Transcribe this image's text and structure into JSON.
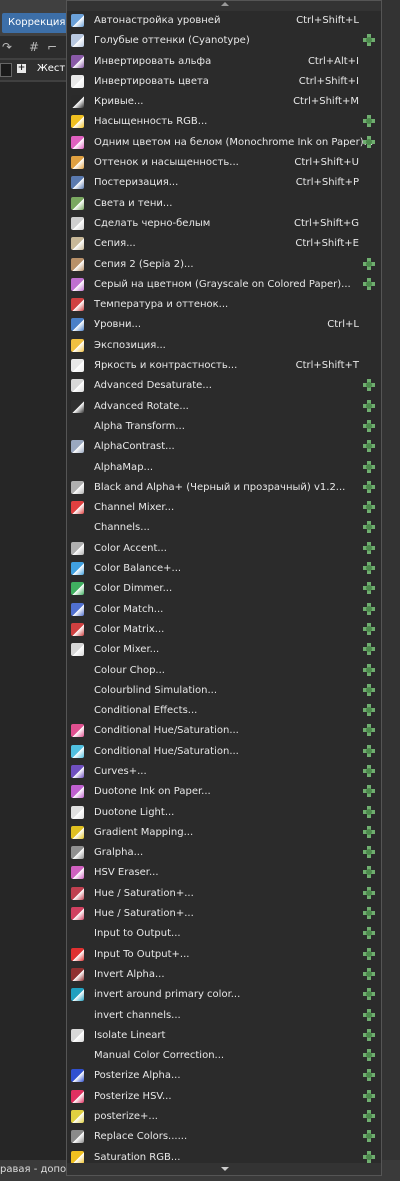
{
  "menubar": {
    "active_menu": "Коррекция"
  },
  "options": {
    "label": "Жестко"
  },
  "status": {
    "text": "равая - допол"
  },
  "menu": {
    "items": [
      {
        "label": "Автонастройка уровней",
        "shortcut": "Ctrl+Shift+L",
        "icon": "auto-levels-icon",
        "color": "#6aa0d8",
        "plugin": false
      },
      {
        "label": "Голубые оттенки (Cyanotype)",
        "shortcut": "",
        "icon": "cyanotype-icon",
        "color": "#b8c8e0",
        "plugin": true
      },
      {
        "label": "Инвертировать альфа",
        "shortcut": "Ctrl+Alt+I",
        "icon": "invert-alpha-icon",
        "color": "#8a5aa8",
        "plugin": false
      },
      {
        "label": "Инвертировать цвета",
        "shortcut": "Ctrl+Shift+I",
        "icon": "invert-colors-icon",
        "color": "#e8e8e8",
        "plugin": false
      },
      {
        "label": "Кривые...",
        "shortcut": "Ctrl+Shift+M",
        "icon": "curves-icon",
        "color": "#2a2a2a",
        "plugin": false
      },
      {
        "label": "Насыщенность RGB...",
        "shortcut": "",
        "icon": "rgb-saturation-icon",
        "color": "#f0c020",
        "plugin": true
      },
      {
        "label": "Одним цветом на белом (Monochrome Ink on Paper)...",
        "shortcut": "",
        "icon": "monochrome-ink-icon",
        "color": "#e060c0",
        "plugin": true
      },
      {
        "label": "Оттенок и насыщенность...",
        "shortcut": "Ctrl+Shift+U",
        "icon": "hue-saturation-icon",
        "color": "#e0a040",
        "plugin": false
      },
      {
        "label": "Постеризация...",
        "shortcut": "Ctrl+Shift+P",
        "icon": "posterize-icon",
        "color": "#5a7ab0",
        "plugin": false
      },
      {
        "label": "Света и тени...",
        "shortcut": "",
        "icon": "shadows-highlights-icon",
        "color": "#7aa860",
        "plugin": false
      },
      {
        "label": "Сделать черно-белым",
        "shortcut": "Ctrl+Shift+G",
        "icon": "black-white-icon",
        "color": "#cfcfcf",
        "plugin": false
      },
      {
        "label": "Сепия...",
        "shortcut": "Ctrl+Shift+E",
        "icon": "sepia-icon",
        "color": "#c8b898",
        "plugin": false
      },
      {
        "label": "Сепия 2 (Sepia 2)...",
        "shortcut": "",
        "icon": "sepia-2-icon",
        "color": "#b89068",
        "plugin": true
      },
      {
        "label": "Серый на цветном (Grayscale on Colored Paper)...",
        "shortcut": "",
        "icon": "grayscale-colored-paper-icon",
        "color": "#c070d0",
        "plugin": true
      },
      {
        "label": "Температура и оттенок...",
        "shortcut": "",
        "icon": "temperature-tint-icon",
        "color": "#d04040",
        "plugin": false
      },
      {
        "label": "Уровни...",
        "shortcut": "Ctrl+L",
        "icon": "levels-icon",
        "color": "#4a80c8",
        "plugin": false
      },
      {
        "label": "Экспозиция...",
        "shortcut": "",
        "icon": "exposure-bulb-icon",
        "color": "#f0c040",
        "plugin": false
      },
      {
        "label": "Яркость и контрастность...",
        "shortcut": "Ctrl+Shift+T",
        "icon": "brightness-contrast-icon",
        "color": "#e8e8e8",
        "plugin": false
      },
      {
        "label": "Advanced Desaturate...",
        "shortcut": "",
        "icon": "advanced-desaturate-icon",
        "color": "#d8d8d8",
        "plugin": true
      },
      {
        "label": "Advanced Rotate...",
        "shortcut": "",
        "icon": "advanced-rotate-icon",
        "color": "#303030",
        "plugin": true
      },
      {
        "label": "Alpha Transform...",
        "shortcut": "",
        "icon": "",
        "color": "",
        "plugin": true
      },
      {
        "label": "AlphaContrast...",
        "shortcut": "",
        "icon": "alpha-contrast-icon",
        "color": "#9aa8c0",
        "plugin": true
      },
      {
        "label": "AlphaMap...",
        "shortcut": "",
        "icon": "",
        "color": "",
        "plugin": true
      },
      {
        "label": "Black and Alpha+ (Черный и прозрачный) v1.2...",
        "shortcut": "",
        "icon": "black-alpha-icon",
        "color": "#b0b0b0",
        "plugin": true
      },
      {
        "label": "Channel Mixer...",
        "shortcut": "",
        "icon": "channel-mixer-icon",
        "color": "#e04040",
        "plugin": true
      },
      {
        "label": "Channels...",
        "shortcut": "",
        "icon": "",
        "color": "",
        "plugin": true
      },
      {
        "label": "Color Accent...",
        "shortcut": "",
        "icon": "color-accent-icon",
        "color": "#b0b0b0",
        "plugin": true
      },
      {
        "label": "Color Balance+...",
        "shortcut": "",
        "icon": "color-balance-icon",
        "color": "#40a0e0",
        "plugin": true
      },
      {
        "label": "Color Dimmer...",
        "shortcut": "",
        "icon": "color-dimmer-icon",
        "color": "#40b060",
        "plugin": true
      },
      {
        "label": "Color Match...",
        "shortcut": "",
        "icon": "color-match-icon",
        "color": "#5070d0",
        "plugin": true
      },
      {
        "label": "Color Matrix...",
        "shortcut": "",
        "icon": "color-matrix-icon",
        "color": "#d04040",
        "plugin": true
      },
      {
        "label": "Color Mixer...",
        "shortcut": "",
        "icon": "color-mixer-icon",
        "color": "#d8d8d8",
        "plugin": true
      },
      {
        "label": "Colour Chop...",
        "shortcut": "",
        "icon": "",
        "color": "",
        "plugin": true
      },
      {
        "label": "Colourblind Simulation...",
        "shortcut": "",
        "icon": "",
        "color": "",
        "plugin": true
      },
      {
        "label": "Conditional Effects...",
        "shortcut": "",
        "icon": "",
        "color": "",
        "plugin": true
      },
      {
        "label": "Conditional Hue/Saturation...",
        "shortcut": "",
        "icon": "conditional-hue-icon",
        "color": "#e05090",
        "plugin": true
      },
      {
        "label": "Conditional Hue/Saturation...",
        "shortcut": "",
        "icon": "conditional-hue-2-icon",
        "color": "#50c0e0",
        "plugin": true
      },
      {
        "label": "Curves+...",
        "shortcut": "",
        "icon": "curves-plus-icon",
        "color": "#7050c0",
        "plugin": true
      },
      {
        "label": "Duotone Ink on Paper...",
        "shortcut": "",
        "icon": "duotone-ink-icon",
        "color": "#c060d0",
        "plugin": true
      },
      {
        "label": "Duotone Light...",
        "shortcut": "",
        "icon": "duotone-light-icon",
        "color": "#e0e0e0",
        "plugin": true
      },
      {
        "label": "Gradient Mapping...",
        "shortcut": "",
        "icon": "gradient-mapping-icon",
        "color": "#e0c020",
        "plugin": true
      },
      {
        "label": "Gralpha...",
        "shortcut": "",
        "icon": "gralpha-icon",
        "color": "#909090",
        "plugin": true
      },
      {
        "label": "HSV Eraser...",
        "shortcut": "",
        "icon": "hsv-eraser-icon",
        "color": "#d060c0",
        "plugin": true
      },
      {
        "label": "Hue / Saturation+...",
        "shortcut": "",
        "icon": "hue-saturation-plus-icon",
        "color": "#c04050",
        "plugin": true
      },
      {
        "label": "Hue / Saturation+...",
        "shortcut": "",
        "icon": "hue-saturation-plus-2-icon",
        "color": "#d04060",
        "plugin": true
      },
      {
        "label": "Input to Output...",
        "shortcut": "",
        "icon": "",
        "color": "",
        "plugin": true
      },
      {
        "label": "Input To Output+...",
        "shortcut": "",
        "icon": "input-to-output-icon",
        "color": "#e03030",
        "plugin": true
      },
      {
        "label": "Invert Alpha...",
        "shortcut": "",
        "icon": "invert-alpha-2-icon",
        "color": "#903030",
        "plugin": true
      },
      {
        "label": "invert around primary color...",
        "shortcut": "",
        "icon": "invert-primary-icon",
        "color": "#20a0c0",
        "plugin": true
      },
      {
        "label": "invert channels...",
        "shortcut": "",
        "icon": "",
        "color": "",
        "plugin": true
      },
      {
        "label": "Isolate Lineart",
        "shortcut": "",
        "icon": "isolate-lineart-icon",
        "color": "#d8d8d8",
        "plugin": true
      },
      {
        "label": "Manual Color Correction...",
        "shortcut": "",
        "icon": "",
        "color": "",
        "plugin": true
      },
      {
        "label": "Posterize Alpha...",
        "shortcut": "",
        "icon": "posterize-alpha-icon",
        "color": "#3050d0",
        "plugin": true
      },
      {
        "label": "Posterize HSV...",
        "shortcut": "",
        "icon": "posterize-hsv-icon",
        "color": "#e03060",
        "plugin": true
      },
      {
        "label": "posterize+...",
        "shortcut": "",
        "icon": "posterize-plus-icon",
        "color": "#e0d040",
        "plugin": true
      },
      {
        "label": "Replace Colors......",
        "shortcut": "",
        "icon": "replace-colors-icon",
        "color": "#8a8a8a",
        "plugin": true
      },
      {
        "label": "Saturation RGB...",
        "shortcut": "",
        "icon": "saturation-rgb-icon",
        "color": "#f0c020",
        "plugin": true
      }
    ]
  }
}
